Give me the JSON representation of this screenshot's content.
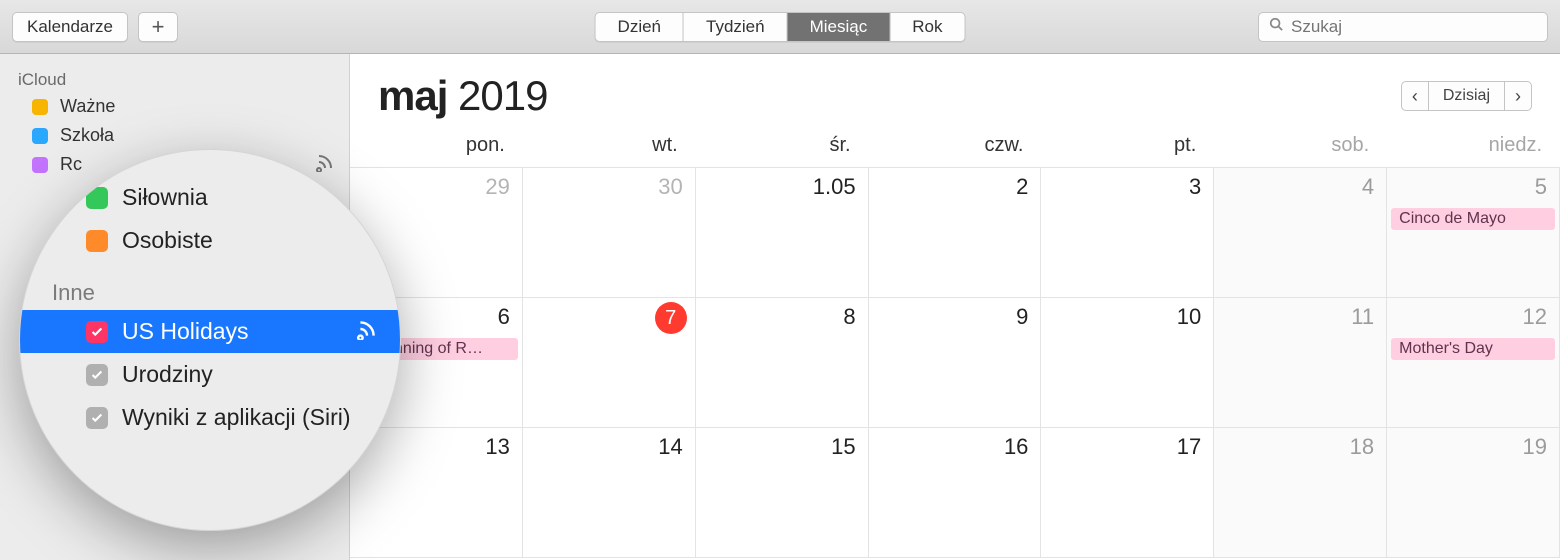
{
  "toolbar": {
    "calendars_label": "Kalendarze",
    "views": {
      "day": "Dzień",
      "week": "Tydzień",
      "month": "Miesiąc",
      "year": "Rok"
    },
    "search_placeholder": "Szukaj"
  },
  "sidebar": {
    "section1": "iCloud",
    "items": [
      {
        "label": "Ważne",
        "color": "#f7b500"
      },
      {
        "label": "Szkoła",
        "color": "#2aa7ff"
      },
      {
        "label": "Rc",
        "color": "#c274ff"
      },
      {
        "label": "Siłownia",
        "color": "#34c759"
      },
      {
        "label": "Osobiste",
        "color": "#ff8a2a"
      }
    ]
  },
  "magnifier": {
    "top_items": [
      {
        "label": "Siłownia",
        "color": "#34c759"
      },
      {
        "label": "Osobiste",
        "color": "#ff8a2a"
      }
    ],
    "section": "Inne",
    "other_items": [
      {
        "label": "US Holidays",
        "selected": true
      },
      {
        "label": "Urodziny",
        "selected": false
      },
      {
        "label": "Wyniki z aplikacji (Siri)",
        "selected": false
      }
    ]
  },
  "calendar": {
    "month_bold": "maj",
    "year": "2019",
    "today_label": "Dzisiaj",
    "dow": [
      "pon.",
      "wt.",
      "śr.",
      "czw.",
      "pt.",
      "sob.",
      "niedz."
    ],
    "rows": [
      [
        {
          "num": "29",
          "dim": true
        },
        {
          "num": "30",
          "dim": true
        },
        {
          "num": "1.05"
        },
        {
          "num": "2"
        },
        {
          "num": "3"
        },
        {
          "num": "4",
          "wknd": true
        },
        {
          "num": "5",
          "wknd": true,
          "event": "Cinco de Mayo"
        }
      ],
      [
        {
          "num": "6",
          "event": "Beginning of R…"
        },
        {
          "num": "7",
          "today": true
        },
        {
          "num": "8"
        },
        {
          "num": "9"
        },
        {
          "num": "10"
        },
        {
          "num": "11",
          "wknd": true
        },
        {
          "num": "12",
          "wknd": true,
          "event": "Mother's Day"
        }
      ],
      [
        {
          "num": "13"
        },
        {
          "num": "14"
        },
        {
          "num": "15"
        },
        {
          "num": "16"
        },
        {
          "num": "17"
        },
        {
          "num": "18",
          "wknd": true
        },
        {
          "num": "19",
          "wknd": true
        }
      ]
    ]
  }
}
